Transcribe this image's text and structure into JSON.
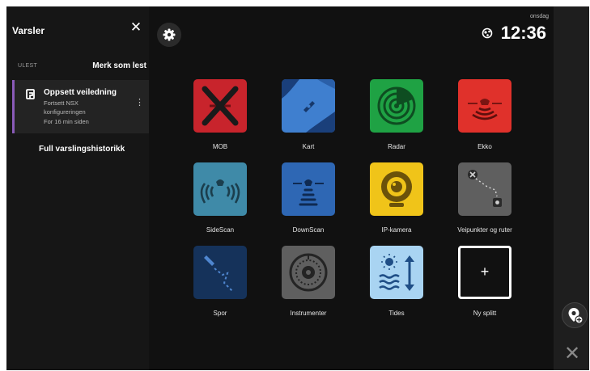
{
  "panel": {
    "title": "Varsler",
    "close_symbol": "✕",
    "unread_label": "ULEST",
    "mark_all_read": "Merk som lest",
    "notification": {
      "title": "Oppsett veiledning",
      "line1": "Fortsett NSX",
      "line2": "konfigureringen",
      "time": "For 16 min siden",
      "menu_symbol": "⋮"
    },
    "history_link": "Full varslingshistorikk"
  },
  "status": {
    "day": "onsdag",
    "time": "12:36"
  },
  "apps": [
    {
      "label": "MOB",
      "icon": "mob-icon",
      "color": "#c8242c"
    },
    {
      "label": "Kart",
      "icon": "chart-icon",
      "color": "#3f7fcf"
    },
    {
      "label": "Radar",
      "icon": "radar-icon",
      "color": "#1fa244"
    },
    {
      "label": "Ekko",
      "icon": "echo-icon",
      "color": "#e0312b"
    },
    {
      "label": "SideScan",
      "icon": "sidescan-icon",
      "color": "#3f8aa8"
    },
    {
      "label": "DownScan",
      "icon": "downscan-icon",
      "color": "#2e67b4"
    },
    {
      "label": "IP-kamera",
      "icon": "camera-icon",
      "color": "#f0c419"
    },
    {
      "label": "Veipunkter og ruter",
      "icon": "waypoints-icon",
      "color": "#5f5f5f"
    },
    {
      "label": "Spor",
      "icon": "track-icon",
      "color": "#15325a"
    },
    {
      "label": "Instrumenter",
      "icon": "instruments-icon",
      "color": "#5f5f5f"
    },
    {
      "label": "Tides",
      "icon": "tides-icon",
      "color": "#a9d4f2"
    },
    {
      "label": "Ny splitt",
      "icon": "plus-icon",
      "color": "#111111",
      "symbol": "+"
    }
  ],
  "controls": {
    "close_symbol": "✕"
  }
}
